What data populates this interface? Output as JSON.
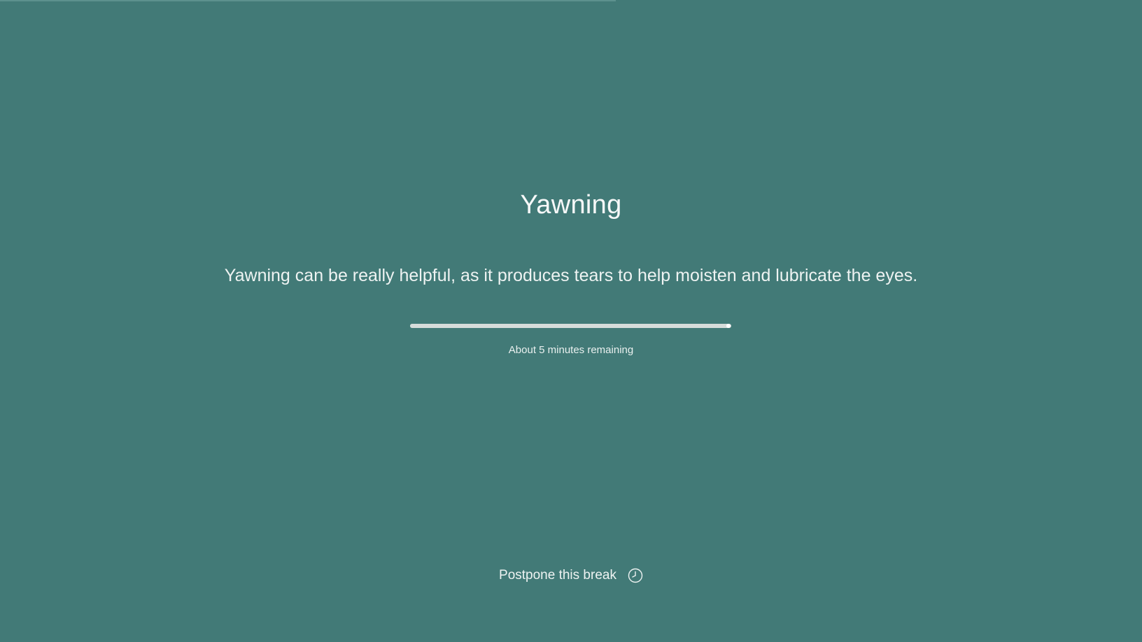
{
  "break": {
    "title": "Yawning",
    "message": "Yawning can be really helpful, as it produces tears to help moisten and lubricate the eyes.",
    "progress_fraction": 0.99,
    "remaining_text": "About 5 minutes remaining"
  },
  "actions": {
    "postpone_label": "Postpone this break",
    "postpone_icon": "clock-icon"
  },
  "colors": {
    "background": "#427a77",
    "text": "#f3f6f5",
    "progress": "#d6dcda"
  }
}
